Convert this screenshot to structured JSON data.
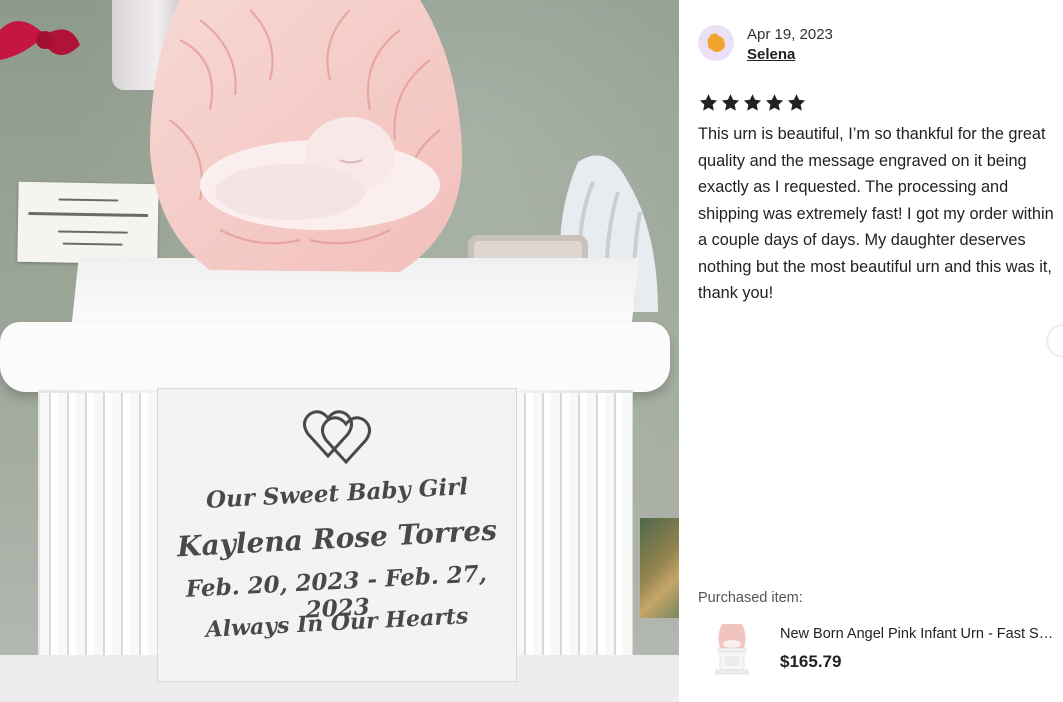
{
  "photo": {
    "alt_icon": "urn-photo",
    "plaque": {
      "line1": "Our Sweet Baby Girl",
      "line2": "Kaylena Rose Torres",
      "line3": "Feb. 20, 2023 - Feb. 27, 2023",
      "line4": "Always In Our Hearts"
    }
  },
  "review": {
    "date": "Apr 19, 2023",
    "author": "Selena",
    "rating": 5,
    "text": "This urn is beautiful, I’m so thankful for the great quality and the message engraved on it being exactly as I requested. The processing and shipping was extremely fast! I got my order within a couple days of days. My daughter deserves nothing but the most beautiful urn and this was it, thank you!",
    "purchased_label": "Purchased item:",
    "item": {
      "title": "New Born Angel Pink Infant Urn - Fast Shipping",
      "price": "$165.79"
    }
  },
  "colors": {
    "star": "#222222",
    "avatar_bg": "#ece0f6",
    "avatar_fg": "#f1a52b"
  }
}
